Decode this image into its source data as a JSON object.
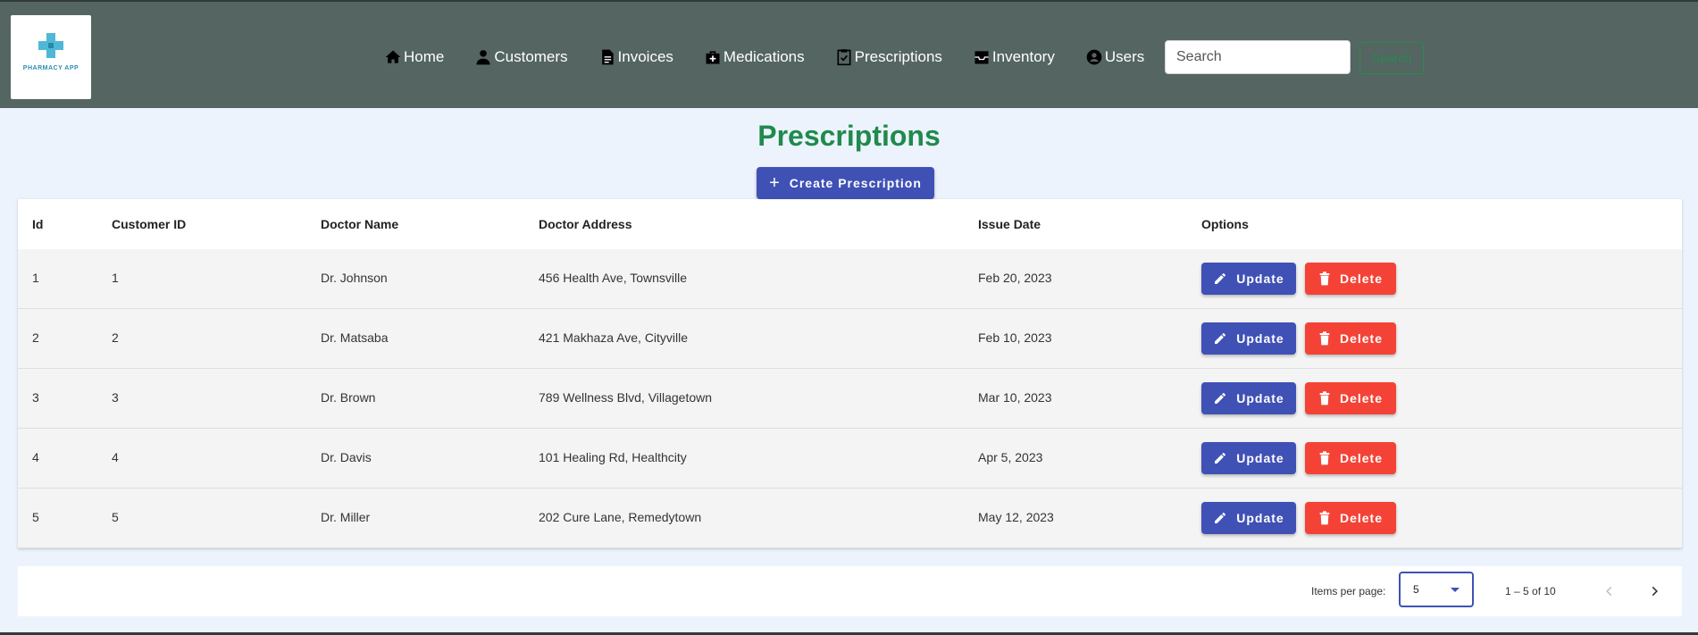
{
  "app": {
    "logo_text": "PHARMACY APP"
  },
  "nav": {
    "items": [
      {
        "label": "Home",
        "icon": "home-icon"
      },
      {
        "label": "Customers",
        "icon": "person-icon"
      },
      {
        "label": "Invoices",
        "icon": "document-icon"
      },
      {
        "label": "Medications",
        "icon": "medkit-icon"
      },
      {
        "label": "Prescriptions",
        "icon": "clipboard-check-icon"
      },
      {
        "label": "Inventory",
        "icon": "inbox-icon"
      },
      {
        "label": "Users",
        "icon": "account-circle-icon"
      }
    ]
  },
  "search": {
    "placeholder": "Search",
    "button_label": "Search"
  },
  "page": {
    "title": "Prescriptions",
    "create_label": "Create Prescription"
  },
  "table": {
    "headers": [
      "Id",
      "Customer ID",
      "Doctor Name",
      "Doctor Address",
      "Issue Date",
      "Options"
    ],
    "rows": [
      {
        "id": "1",
        "customer_id": "1",
        "doctor_name": "Dr. Johnson",
        "doctor_address": "456 Health Ave, Townsville",
        "issue_date": "Feb 20, 2023"
      },
      {
        "id": "2",
        "customer_id": "2",
        "doctor_name": "Dr. Matsaba",
        "doctor_address": "421 Makhaza Ave, Cityville",
        "issue_date": "Feb 10, 2023"
      },
      {
        "id": "3",
        "customer_id": "3",
        "doctor_name": "Dr. Brown",
        "doctor_address": "789 Wellness Blvd, Villagetown",
        "issue_date": "Mar 10, 2023"
      },
      {
        "id": "4",
        "customer_id": "4",
        "doctor_name": "Dr. Davis",
        "doctor_address": "101 Healing Rd, Healthcity",
        "issue_date": "Apr 5, 2023"
      },
      {
        "id": "5",
        "customer_id": "5",
        "doctor_name": "Dr. Miller",
        "doctor_address": "202 Cure Lane, Remedytown",
        "issue_date": "May 12, 2023"
      }
    ],
    "update_label": "Update",
    "delete_label": "Delete"
  },
  "paginator": {
    "items_per_page_label": "Items per page:",
    "items_per_page": "5",
    "range_label": "1 – 5 of 10"
  },
  "colors": {
    "navbar": "#546562",
    "title": "#1f8a4c",
    "primary": "#3f51b5",
    "danger": "#f44336",
    "background": "#ecf3fd"
  }
}
